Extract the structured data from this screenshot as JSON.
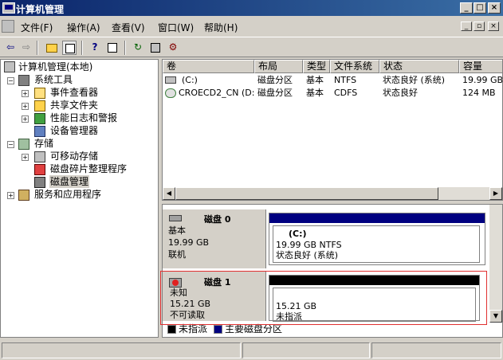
{
  "window": {
    "title": "计算机管理"
  },
  "menu": [
    "文件(F)",
    "操作(A)",
    "查看(V)",
    "窗口(W)",
    "帮助(H)"
  ],
  "tree": {
    "root": "计算机管理(本地)",
    "system_tools": "系统工具",
    "event_viewer": "事件查看器",
    "shared_folders": "共享文件夹",
    "perf_logs": "性能日志和警报",
    "device_manager": "设备管理器",
    "storage": "存储",
    "removable": "可移动存储",
    "defrag": "磁盘碎片整理程序",
    "disk_mgmt": "磁盘管理",
    "services_apps": "服务和应用程序"
  },
  "columns": [
    "卷",
    "布局",
    "类型",
    "文件系统",
    "状态",
    "容量"
  ],
  "volumes": [
    {
      "name": "(C:)",
      "layout": "磁盘分区",
      "type": "基本",
      "fs": "NTFS",
      "status": "状态良好 (系统)",
      "capacity": "19.99 GB"
    },
    {
      "name": "CROECD2_CN (D:)",
      "layout": "磁盘分区",
      "type": "基本",
      "fs": "CDFS",
      "status": "状态良好",
      "capacity": "124 MB"
    }
  ],
  "disks": [
    {
      "name": "磁盘 0",
      "type": "基本",
      "size": "19.99 GB",
      "state": "联机",
      "vol_label": "(C:)",
      "vol_size": "19.99 GB NTFS",
      "vol_status": "状态良好 (系统)",
      "bar_color": "#000080"
    },
    {
      "name": "磁盘 1",
      "type": "未知",
      "size": "15.21 GB",
      "state": "不可读取",
      "vol_size": "15.21 GB",
      "vol_status": "未指派",
      "bar_color": "#000000"
    }
  ],
  "legend": {
    "unallocated": "未指派",
    "primary": "主要磁盘分区"
  },
  "colors": {
    "unallocated": "#000000",
    "primary": "#000080",
    "highlight": "#e03030"
  }
}
